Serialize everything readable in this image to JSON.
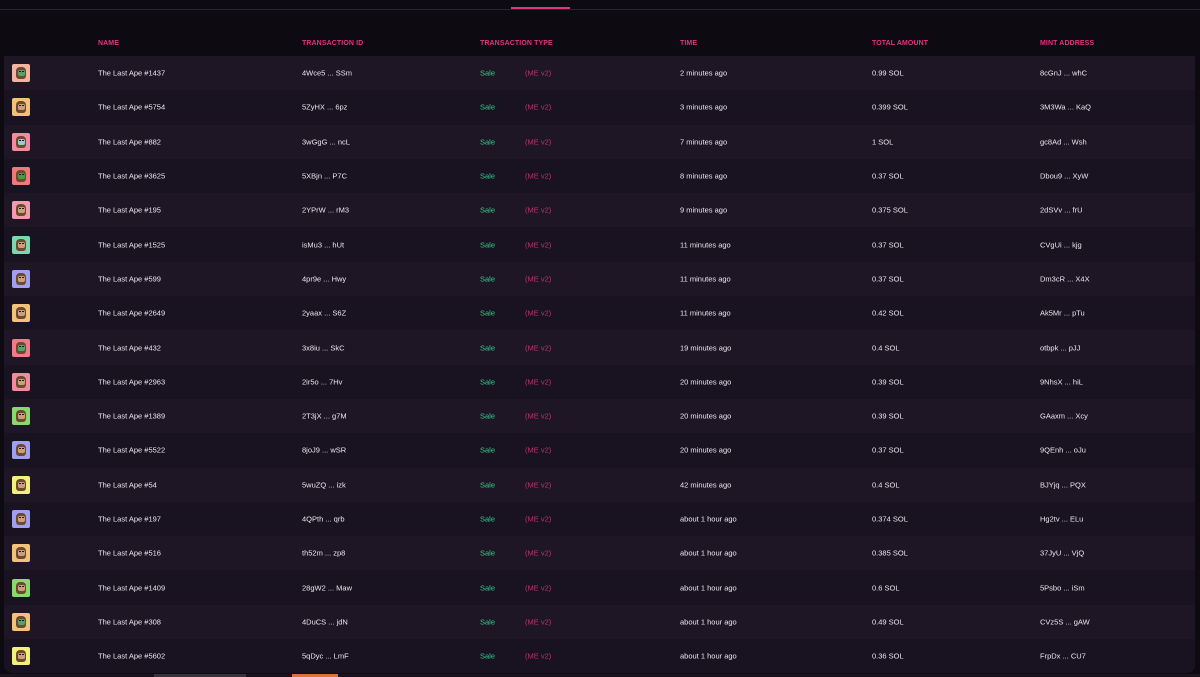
{
  "colors": {
    "accent": "#e0357f",
    "sale": "#2fd18a",
    "marketplace": "#c03070",
    "text": "#ece6f0",
    "background": "#0e0a12"
  },
  "table": {
    "headers": {
      "name": "NAME",
      "transaction_id": "TRANSACTION ID",
      "transaction_type": "TRANSACTION TYPE",
      "time": "TIME",
      "total_amount": "TOTAL AMOUNT",
      "mint_address": "MINT ADDRESS"
    },
    "rows": [
      {
        "name": "The Last Ape #1437",
        "tx": "4Wce5 ... SSm",
        "type": "Sale",
        "market": "(ME v2)",
        "time": "2 minutes ago",
        "amount": "0.99 SOL",
        "mint": "8cGnJ ... whC",
        "avatar_bg": "#f4b3a0",
        "skin": "#5aa06a"
      },
      {
        "name": "The Last Ape #5754",
        "tx": "5ZyHX ... 6pz",
        "type": "Sale",
        "market": "(ME v2)",
        "time": "3 minutes ago",
        "amount": "0.399 SOL",
        "mint": "3M3Wa ... KaQ",
        "avatar_bg": "#f2c27a",
        "skin": "#c9a07a"
      },
      {
        "name": "The Last Ape #882",
        "tx": "3wGgG ... ncL",
        "type": "Sale",
        "market": "(ME v2)",
        "time": "7 minutes ago",
        "amount": "1 SOL",
        "mint": "gc8Ad ... Wsh",
        "avatar_bg": "#f48aa0",
        "skin": "#8fd0d0"
      },
      {
        "name": "The Last Ape #3625",
        "tx": "5XBjn ... P7C",
        "type": "Sale",
        "market": "(ME v2)",
        "time": "8 minutes ago",
        "amount": "0.37 SOL",
        "mint": "Dbou9 ... XyW",
        "avatar_bg": "#f07a7a",
        "skin": "#4a9a4a"
      },
      {
        "name": "The Last Ape #195",
        "tx": "2YPrW ... rM3",
        "type": "Sale",
        "market": "(ME v2)",
        "time": "9 minutes ago",
        "amount": "0.375 SOL",
        "mint": "2dSVv ... frU",
        "avatar_bg": "#f49ab0",
        "skin": "#c9a07a"
      },
      {
        "name": "The Last Ape #1525",
        "tx": "isMu3 ... hUt",
        "type": "Sale",
        "market": "(ME v2)",
        "time": "11 minutes ago",
        "amount": "0.37 SOL",
        "mint": "CVgUi ... kjg",
        "avatar_bg": "#7ad8b0",
        "skin": "#c9a07a"
      },
      {
        "name": "The Last Ape #599",
        "tx": "4pr9e ... Hwy",
        "type": "Sale",
        "market": "(ME v2)",
        "time": "11 minutes ago",
        "amount": "0.37 SOL",
        "mint": "Dm3cR ... X4X",
        "avatar_bg": "#a0a0f0",
        "skin": "#c9a07a"
      },
      {
        "name": "The Last Ape #2649",
        "tx": "2yaax ... S6Z",
        "type": "Sale",
        "market": "(ME v2)",
        "time": "11 minutes ago",
        "amount": "0.42 SOL",
        "mint": "Ak5Mr ... pTu",
        "avatar_bg": "#f2c27a",
        "skin": "#c9a07a"
      },
      {
        "name": "The Last Ape #432",
        "tx": "3x8iu ... SkC",
        "type": "Sale",
        "market": "(ME v2)",
        "time": "19 minutes ago",
        "amount": "0.4 SOL",
        "mint": "otbpk ... pJJ",
        "avatar_bg": "#f07a8a",
        "skin": "#5aa06a"
      },
      {
        "name": "The Last Ape #2963",
        "tx": "2ir5o ... 7Hv",
        "type": "Sale",
        "market": "(ME v2)",
        "time": "20 minutes ago",
        "amount": "0.39 SOL",
        "mint": "9NhsX ... hiL",
        "avatar_bg": "#f48aa0",
        "skin": "#c9a07a"
      },
      {
        "name": "The Last Ape #1389",
        "tx": "2T3jX ... g7M",
        "type": "Sale",
        "market": "(ME v2)",
        "time": "20 minutes ago",
        "amount": "0.39 SOL",
        "mint": "GAaxm ... Xcy",
        "avatar_bg": "#8ad870",
        "skin": "#c9a07a"
      },
      {
        "name": "The Last Ape #5522",
        "tx": "8joJ9 ... wSR",
        "type": "Sale",
        "market": "(ME v2)",
        "time": "20 minutes ago",
        "amount": "0.37 SOL",
        "mint": "9QEnh ... oJu",
        "avatar_bg": "#a0a0f0",
        "skin": "#c9a07a"
      },
      {
        "name": "The Last Ape #54",
        "tx": "5wuZQ ... izk",
        "type": "Sale",
        "market": "(ME v2)",
        "time": "42 minutes ago",
        "amount": "0.4 SOL",
        "mint": "BJYjq ... PQX",
        "avatar_bg": "#f0f07a",
        "skin": "#c9a07a"
      },
      {
        "name": "The Last Ape #197",
        "tx": "4QPth ... qrb",
        "type": "Sale",
        "market": "(ME v2)",
        "time": "about 1 hour ago",
        "amount": "0.374 SOL",
        "mint": "Hg2tv ... ELu",
        "avatar_bg": "#a0a0f0",
        "skin": "#c9a07a"
      },
      {
        "name": "The Last Ape #516",
        "tx": "th52m ... zp8",
        "type": "Sale",
        "market": "(ME v2)",
        "time": "about 1 hour ago",
        "amount": "0.385 SOL",
        "mint": "37JyU ... VjQ",
        "avatar_bg": "#f2c27a",
        "skin": "#c9a07a"
      },
      {
        "name": "The Last Ape #1409",
        "tx": "28gW2 ... Maw",
        "type": "Sale",
        "market": "(ME v2)",
        "time": "about 1 hour ago",
        "amount": "0.6 SOL",
        "mint": "5Psbo ... iSm",
        "avatar_bg": "#8ad870",
        "skin": "#c9a07a"
      },
      {
        "name": "The Last Ape #308",
        "tx": "4DuCS ... jdN",
        "type": "Sale",
        "market": "(ME v2)",
        "time": "about 1 hour ago",
        "amount": "0.49 SOL",
        "mint": "CVz5S ... gAW",
        "avatar_bg": "#f2c27a",
        "skin": "#5aa06a"
      },
      {
        "name": "The Last Ape #5602",
        "tx": "5qDyc ... LmF",
        "type": "Sale",
        "market": "(ME v2)",
        "time": "about 1 hour ago",
        "amount": "0.36 SOL",
        "mint": "FrpDx ... CU7",
        "avatar_bg": "#f0f07a",
        "skin": "#c9a07a"
      }
    ]
  }
}
